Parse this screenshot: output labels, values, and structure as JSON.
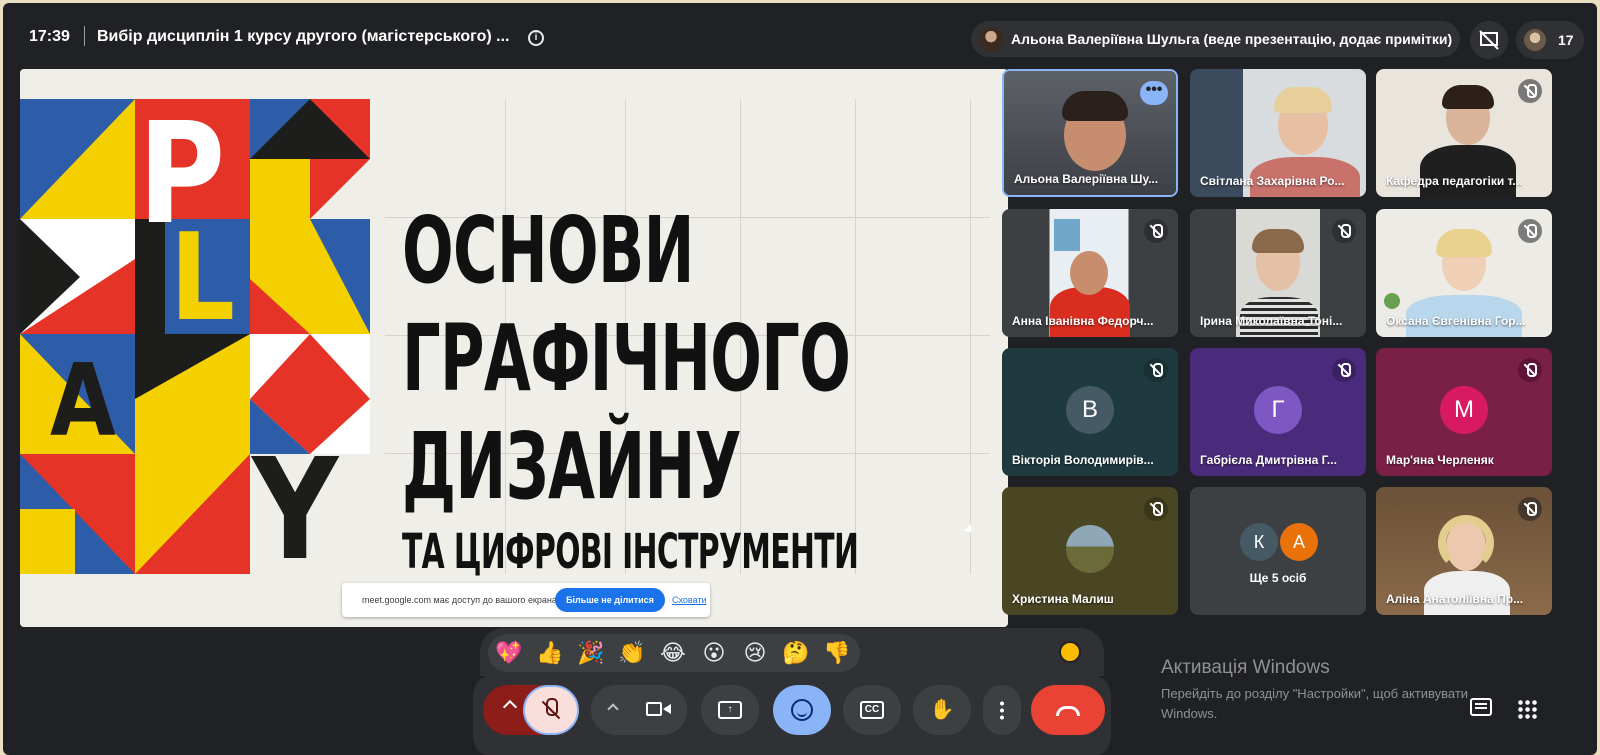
{
  "header": {
    "time": "17:39",
    "meeting_title": "Вибір дисциплін 1 курсу другого (магістерського) ...",
    "presenter_label": "Альона Валеріївна Шульга (веде презентацію, додає примітки)",
    "participant_count": "17"
  },
  "slide": {
    "art_letters": [
      "P",
      "L",
      "A",
      "Y"
    ],
    "title_lines": [
      "ОСНОВИ",
      "ГРАФІЧНОГО",
      "ДИЗАЙНУ"
    ],
    "subtitle": "ТА ЦИФРОВІ ІНСТРУМЕНТИ",
    "share_notice": "meet.google.com має доступ до вашого екрана.",
    "stop_sharing_label": "Більше не ділитися",
    "hide_label": "Сховати"
  },
  "participants": [
    {
      "name": "Альона Валеріївна Шу...",
      "type": "video"
    },
    {
      "name": "Світлана Захарівна Ро...",
      "type": "video"
    },
    {
      "name": "Кафедра педагогіки т...",
      "type": "video",
      "muted": true
    },
    {
      "name": "Анна Іванівна Федорч...",
      "type": "video",
      "muted": true
    },
    {
      "name": "Ірина Миколаївна Тоні...",
      "type": "video",
      "muted": true
    },
    {
      "name": "Оксана Євгенівна Гор...",
      "type": "video",
      "muted": true
    },
    {
      "name": "Вікторія Володимирів...",
      "type": "avatar",
      "initial": "В",
      "color": "#455a64",
      "bg": "#1e3a3f",
      "muted": true
    },
    {
      "name": "Габрієла Дмитрівна Г...",
      "type": "avatar",
      "initial": "Г",
      "color": "#7e57c2",
      "bg": "#4a2a7a",
      "muted": true
    },
    {
      "name": "Мар'яна Черленяк",
      "type": "avatar",
      "initial": "М",
      "color": "#d81b60",
      "bg": "#7a1f45",
      "muted": true
    },
    {
      "name": "Христина Малиш",
      "type": "photo",
      "bg": "#4a4522",
      "muted": true
    },
    {
      "name": "Ще 5 осіб",
      "type": "more",
      "initials": [
        "К",
        "А"
      ],
      "colors": [
        "#455a64",
        "#e8710a"
      ]
    },
    {
      "name": "Аліна Анатоліївна Пр...",
      "type": "video",
      "muted": true
    }
  ],
  "reactions": [
    "💖",
    "👍",
    "🎉",
    "👏",
    "😂",
    "😮",
    "😢",
    "🤔",
    "👎"
  ],
  "controls": {
    "mic": "microphone-off",
    "camera": "camera",
    "present": "present-screen",
    "emoji": "emoji",
    "captions": "CC",
    "hand": "✋",
    "more": "more-options",
    "end_call": "leave-call"
  },
  "watermark": {
    "title": "Активація Windows",
    "subtitle": "Перейдіть до розділу \"Настройки\", щоб активувати Windows."
  },
  "colors": {
    "background": "#202124",
    "accent_blue": "#8ab4f8",
    "end_red": "#ea4335",
    "mic_off_red": "#8c1d18"
  }
}
